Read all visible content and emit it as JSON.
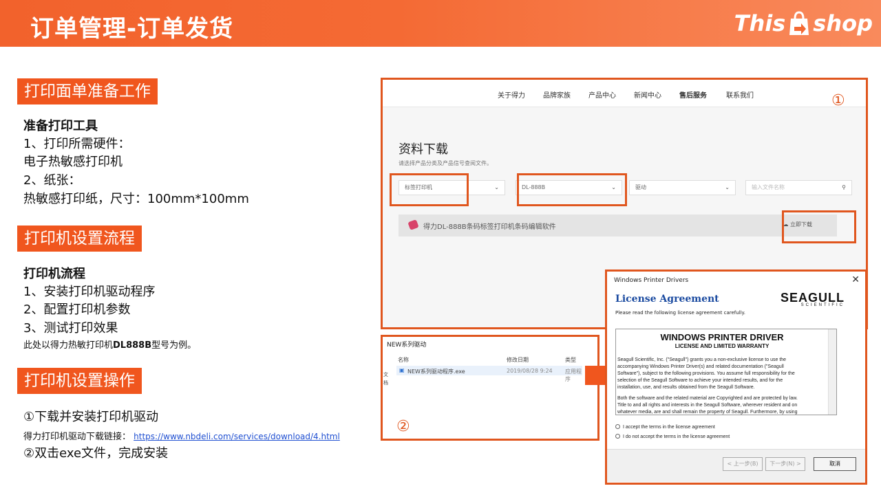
{
  "header": {
    "title": "订单管理-订单发货",
    "logo_left": "This",
    "logo_right": "shop"
  },
  "sections": {
    "prep": {
      "tag": "打印面单准备工作",
      "heading": "准备打印工具",
      "line1": "1、打印所需硬件：",
      "line2": "电子热敏感打印机",
      "line3": "2、纸张：",
      "line4": "热敏感打印纸，尺寸：100mm*100mm"
    },
    "flow": {
      "tag": "打印机设置流程",
      "heading": "打印机流程",
      "line1": "1、安装打印机驱动程序",
      "line2": "2、配置打印机参数",
      "line3": "3、测试打印效果",
      "note_a": "此处以得力热敏打印机",
      "note_b": "DL888B",
      "note_c": "型号为例。"
    },
    "ops": {
      "tag": "打印机设置操作",
      "step1": "①下载并安装打印机驱动",
      "link_label": "得力打印机驱动下载链接：",
      "link_url": "https://www.nbdeli.com/services/download/4.html",
      "step2": "②双击exe文件，完成安装"
    }
  },
  "panel1": {
    "marker": "①",
    "nav": [
      "关于得力",
      "品牌家族",
      "产品中心",
      "新闻中心",
      "售后服务",
      "联系我们"
    ],
    "heading": "资料下载",
    "subheading": "请选择产品分类及产品信号查阅文件。",
    "selects": [
      "标签打印机",
      "DL-888B",
      "驱动"
    ],
    "search_placeholder": "输入文件名称",
    "file_name": "得力DL-888B条码标签打印机条码编辑软件",
    "download_label": "立即下载"
  },
  "panel2": {
    "marker": "②",
    "title": "NEW系列驱动",
    "col_name": "名称",
    "col_date": "修改日期",
    "col_type": "类型",
    "file": "NEW系列驱动程序.exe",
    "date": "2019/08/28 9:24",
    "type": "应用程序",
    "side1": "文",
    "side2": "档"
  },
  "panel3": {
    "window_title": "Windows Printer Drivers",
    "license_title": "License Agreement",
    "license_sub": "Please read the following license agreement carefully.",
    "brand": "SEAGULL",
    "brand_sub": "SCIENTIFIC",
    "doc_title": "WINDOWS PRINTER DRIVER",
    "doc_subtitle": "LICENSE AND LIMITED WARRANTY",
    "para1a": "Seagull Scientific, Inc. (\"Seagull\") grants you a non-exclusive license to use the",
    "para1b": "accompanying Windows Printer Driver(s) and related documentation (\"Seagull",
    "para1c": "Software\"), subject to the following provisions.  You assume full responsibility for the",
    "para1d": "selection of the Seagull Software to achieve your intended results, and for the",
    "para1e": "installation, use, and results obtained from the Seagull Software.",
    "para2a": "Both the software and the related material are Copyrighted and are protected by law.",
    "para2b": "Title to and all rights and interests in the Seagull Software, wherever resident and on",
    "para2c": "whatever media, are and shall remain the property of Seagull.  Furthermore, by using",
    "accept": "I accept the terms in the license agreement",
    "decline": "I do not accept the terms in the license agreement",
    "back": "< 上一步(B)",
    "next": "下一步(N) >",
    "cancel": "取消"
  },
  "colors": {
    "accent": "#f0561e",
    "link": "#1f4fd1",
    "license_title": "#1a4aa0"
  }
}
